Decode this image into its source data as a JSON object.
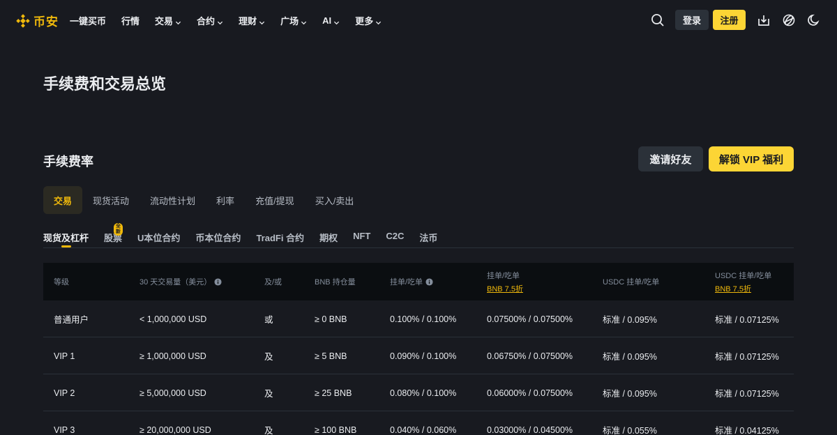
{
  "brand": {
    "name": "币安",
    "color": "#f0b90b"
  },
  "nav": {
    "items": [
      {
        "label": "一键买币",
        "dropdown": false
      },
      {
        "label": "行情",
        "dropdown": false
      },
      {
        "label": "交易",
        "dropdown": true
      },
      {
        "label": "合约",
        "dropdown": true
      },
      {
        "label": "理财",
        "dropdown": true
      },
      {
        "label": "广场",
        "dropdown": true
      },
      {
        "label": "AI",
        "dropdown": true
      },
      {
        "label": "更多",
        "dropdown": true
      }
    ],
    "login_label": "登录",
    "register_label": "注册",
    "icons": [
      "search-icon",
      "download-icon",
      "globe-icon",
      "moon-icon"
    ]
  },
  "page": {
    "title": "手续费和交易总览",
    "section_title": "手续费率",
    "invite_label": "邀请好友",
    "vip_label": "解锁 VIP 福利"
  },
  "tabs": [
    "交易",
    "现货活动",
    "流动性计划",
    "利率",
    "充值/提现",
    "买入/卖出"
  ],
  "active_tab": "交易",
  "subtabs": [
    {
      "label": "现货及杠杆",
      "badge": ""
    },
    {
      "label": "股票",
      "badge": "全新"
    },
    {
      "label": "U本位合约",
      "badge": ""
    },
    {
      "label": "币本位合约",
      "badge": ""
    },
    {
      "label": "TradFi 合约",
      "badge": ""
    },
    {
      "label": "期权",
      "badge": ""
    },
    {
      "label": "NFT",
      "badge": ""
    },
    {
      "label": "C2C",
      "badge": ""
    },
    {
      "label": "法币",
      "badge": ""
    }
  ],
  "active_subtab": "现货及杠杆",
  "table": {
    "headers": [
      {
        "label": "等级",
        "sub": "",
        "info": false
      },
      {
        "label": "30 天交易量（美元）",
        "sub": "",
        "info": true
      },
      {
        "label": "及/或",
        "sub": "",
        "info": false
      },
      {
        "label": "BNB 持仓量",
        "sub": "",
        "info": false
      },
      {
        "label": "挂单/吃单",
        "sub": "",
        "info": true
      },
      {
        "label": "挂单/吃单",
        "sub": "BNB 7.5折",
        "info": false
      },
      {
        "label": "USDC 挂单/吃单",
        "sub": "",
        "info": false
      },
      {
        "label": "USDC 挂单/吃单",
        "sub": "BNB 7.5折",
        "info": false
      }
    ],
    "rows": [
      [
        "普通用户",
        "< 1,000,000 USD",
        "或",
        "≥ 0 BNB",
        "0.100% / 0.100%",
        "0.07500% / 0.07500%",
        "标准 / 0.095%",
        "标准 / 0.07125%"
      ],
      [
        "VIP 1",
        "≥ 1,000,000 USD",
        "及",
        "≥ 5 BNB",
        "0.090% / 0.100%",
        "0.06750% / 0.07500%",
        "标准 / 0.095%",
        "标准 / 0.07125%"
      ],
      [
        "VIP 2",
        "≥ 5,000,000 USD",
        "及",
        "≥ 25 BNB",
        "0.080% / 0.100%",
        "0.06000% / 0.07500%",
        "标准 / 0.095%",
        "标准 / 0.07125%"
      ],
      [
        "VIP 3",
        "≥ 20,000,000 USD",
        "及",
        "≥ 100 BNB",
        "0.040% / 0.060%",
        "0.03000% / 0.04500%",
        "标准 / 0.055%",
        "标准 / 0.04125%"
      ]
    ]
  },
  "colors": {
    "background": "#181a20",
    "accent": "#fcd535",
    "header_bg": "#0b0e11",
    "muted": "#848e9c"
  }
}
